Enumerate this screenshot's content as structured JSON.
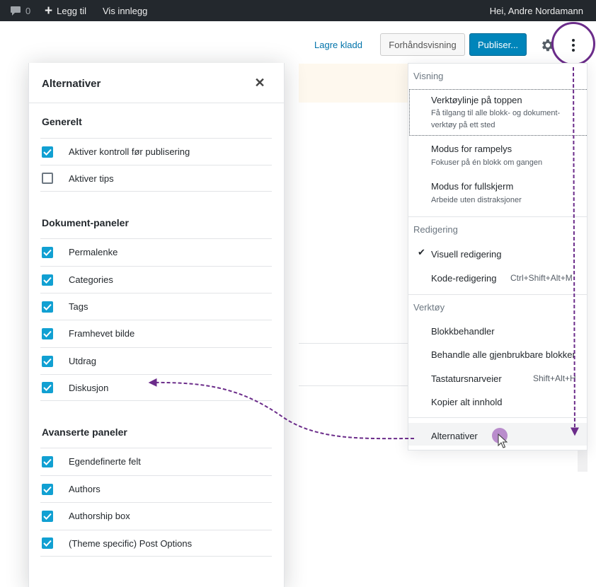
{
  "adminbar": {
    "comments_count": "0",
    "add_new_label": "Legg til",
    "view_post_label": "Vis innlegg",
    "greeting": "Hei, Andre Nordamann"
  },
  "header": {
    "save_draft_label": "Lagre kladd",
    "preview_label": "Forhåndsvisning",
    "publish_label": "Publiser..."
  },
  "modal": {
    "title": "Alternativer",
    "close_symbol": "✕",
    "sections": [
      {
        "title": "Generelt",
        "options": [
          {
            "label": "Aktiver kontroll før publisering",
            "checked": true
          },
          {
            "label": "Aktiver tips",
            "checked": false
          }
        ]
      },
      {
        "title": "Dokument-paneler",
        "options": [
          {
            "label": "Permalenke",
            "checked": true
          },
          {
            "label": "Categories",
            "checked": true
          },
          {
            "label": "Tags",
            "checked": true
          },
          {
            "label": "Framhevet bilde",
            "checked": true
          },
          {
            "label": "Utdrag",
            "checked": true
          },
          {
            "label": "Diskusjon",
            "checked": true
          }
        ]
      },
      {
        "title": "Avanserte paneler",
        "options": [
          {
            "label": "Egendefinerte felt",
            "checked": true
          },
          {
            "label": "Authors",
            "checked": true
          },
          {
            "label": "Authorship box",
            "checked": true
          },
          {
            "label": "(Theme specific) Post Options",
            "checked": true
          }
        ]
      }
    ]
  },
  "menu": {
    "view": {
      "label": "Visning",
      "top_toolbar": "Verktøylinje på toppen",
      "top_toolbar_desc_1": "Få tilgang til alle blokk- og dokument-",
      "top_toolbar_desc_2": "verktøy på ett sted",
      "spotlight": "Modus for rampelys",
      "spotlight_desc": "Fokuser på én blokk om gangen",
      "fullscreen": "Modus for fullskjerm",
      "fullscreen_desc": "Arbeide uten distraksjoner"
    },
    "editing": {
      "label": "Redigering",
      "check": "✔",
      "visual": "Visuell redigering",
      "code": "Kode-redigering",
      "code_shortcut": "Ctrl+Shift+Alt+M"
    },
    "tools": {
      "label": "Verktøy",
      "block_manager": "Blokkbehandler",
      "reusable": "Behandle alle gjenbrukbare blokker",
      "shortcuts": "Tastatursnarveier",
      "shortcuts_key": "Shift+Alt+H",
      "copy_all": "Kopier alt innhold"
    },
    "options_item": "Alternativer"
  },
  "colors": {
    "accent_purple": "#6b2c8a",
    "checkbox_blue": "#11a0d2",
    "publish_blue": "#0085ba",
    "adminbar_bg": "#23282d"
  }
}
